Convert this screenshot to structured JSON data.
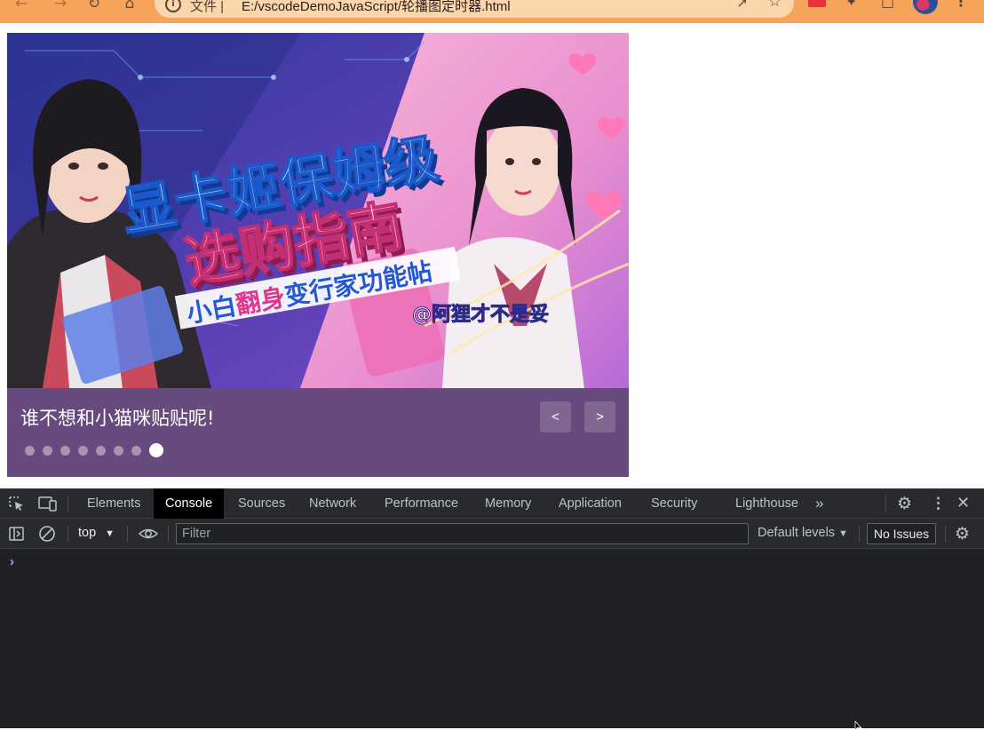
{
  "browser": {
    "url_protocol": "文件 |",
    "url": "E:/vscodeDemoJavaScript/轮播图定时器.html"
  },
  "carousel": {
    "caption": "谁不想和小猫咪贴贴呢!",
    "prev_label": "<",
    "next_label": ">",
    "dot_count": 8,
    "active_index": 7,
    "image": {
      "title_line1": "显卡姬保姆级",
      "title_line2": "选购指南",
      "subtitle": "小白翻身变行家功能帖",
      "handle": "@阿狸才不是妥"
    }
  },
  "devtools": {
    "tabs": [
      {
        "label": "Elements"
      },
      {
        "label": "Console"
      },
      {
        "label": "Sources"
      },
      {
        "label": "Network"
      },
      {
        "label": "Performance"
      },
      {
        "label": "Memory"
      },
      {
        "label": "Application"
      },
      {
        "label": "Security"
      },
      {
        "label": "Lighthouse"
      }
    ],
    "active_tab": "Console",
    "context": "top",
    "filter_placeholder": "Filter",
    "levels": "Default levels",
    "issues": "No Issues",
    "prompt": "›"
  },
  "colors": {
    "browser_bar": "#f6a35c",
    "caption_bg": "#674a7e",
    "devtools_bg": "#202124",
    "devtools_toolbar": "#292a2d",
    "prompt": "#8ab4f8"
  },
  "icons": [
    "back-icon",
    "forward-icon",
    "reload-icon",
    "home-icon",
    "info-icon",
    "share-icon",
    "star-icon",
    "extension-icon",
    "puzzle-icon",
    "window-icon",
    "menu-icon",
    "inspect-icon",
    "device-toggle-icon",
    "more-tabs-icon",
    "settings-icon",
    "kebab-icon",
    "close-icon",
    "sidebar-icon",
    "clear-icon",
    "eye-icon",
    "dropdown-arrow-icon",
    "console-settings-icon"
  ]
}
